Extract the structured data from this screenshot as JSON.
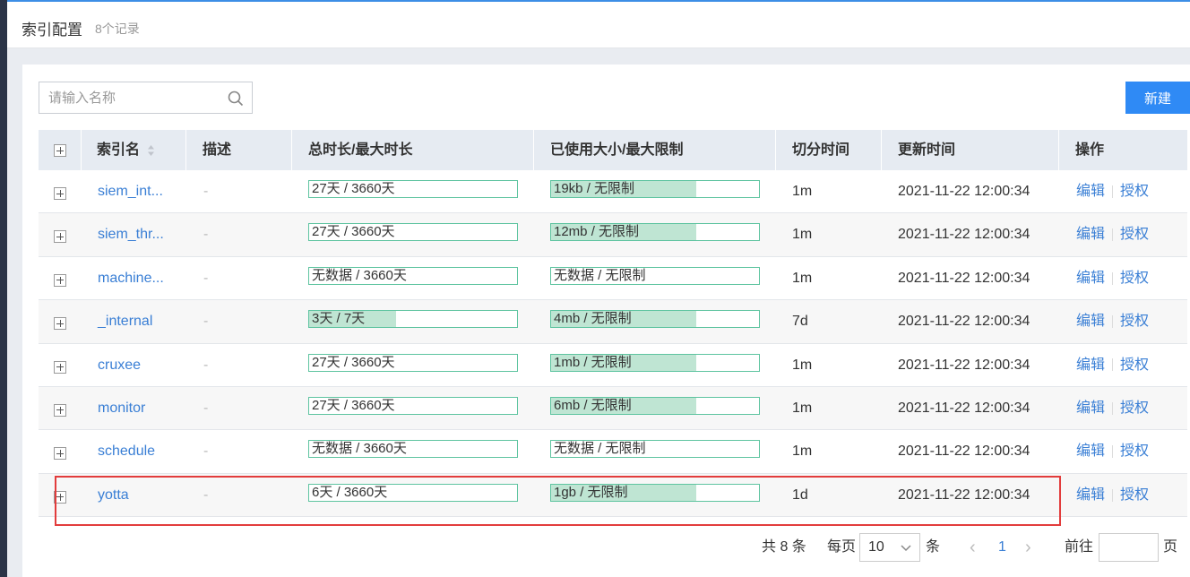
{
  "header": {
    "title": "索引配置",
    "count": "8个记录"
  },
  "search": {
    "placeholder": "请输入名称"
  },
  "toolbar": {
    "new_label": "新建"
  },
  "table": {
    "columns": [
      "索引名",
      "描述",
      "总时长/最大时长",
      "已使用大小/最大限制",
      "切分时间",
      "更新时间",
      "操作"
    ],
    "rows": [
      {
        "name": "siem_int...",
        "desc": "-",
        "duration": "27天 / 3660天",
        "duration_pct": 0,
        "size": "19kb / 无限制",
        "size_pct": 70,
        "split": "1m",
        "updated": "2021-11-22 12:00:34",
        "edit": "编辑",
        "auth": "授权"
      },
      {
        "name": "siem_thr...",
        "desc": "-",
        "duration": "27天 / 3660天",
        "duration_pct": 0,
        "size": "12mb / 无限制",
        "size_pct": 70,
        "split": "1m",
        "updated": "2021-11-22 12:00:34",
        "edit": "编辑",
        "auth": "授权"
      },
      {
        "name": "machine...",
        "desc": "-",
        "duration": "无数据 / 3660天",
        "duration_pct": 0,
        "size": "无数据 / 无限制",
        "size_pct": 0,
        "split": "1m",
        "updated": "2021-11-22 12:00:34",
        "edit": "编辑",
        "auth": "授权"
      },
      {
        "name": "_internal",
        "desc": "-",
        "duration": "3天 / 7天",
        "duration_pct": 42,
        "size": "4mb / 无限制",
        "size_pct": 70,
        "split": "7d",
        "updated": "2021-11-22 12:00:34",
        "edit": "编辑",
        "auth": "授权"
      },
      {
        "name": "cruxee",
        "desc": "-",
        "duration": "27天 / 3660天",
        "duration_pct": 0,
        "size": "1mb / 无限制",
        "size_pct": 70,
        "split": "1m",
        "updated": "2021-11-22 12:00:34",
        "edit": "编辑",
        "auth": "授权"
      },
      {
        "name": "monitor",
        "desc": "-",
        "duration": "27天 / 3660天",
        "duration_pct": 0,
        "size": "6mb / 无限制",
        "size_pct": 70,
        "split": "1m",
        "updated": "2021-11-22 12:00:34",
        "edit": "编辑",
        "auth": "授权"
      },
      {
        "name": "schedule",
        "desc": "-",
        "duration": "无数据 / 3660天",
        "duration_pct": 0,
        "size": "无数据 / 无限制",
        "size_pct": 0,
        "split": "1m",
        "updated": "2021-11-22 12:00:34",
        "edit": "编辑",
        "auth": "授权"
      },
      {
        "name": "yotta",
        "desc": "-",
        "duration": "6天 / 3660天",
        "duration_pct": 0,
        "size": "1gb / 无限制",
        "size_pct": 70,
        "split": "1d",
        "updated": "2021-11-22 12:00:34",
        "edit": "编辑",
        "auth": "授权"
      }
    ]
  },
  "pagination": {
    "total": "共 8 条",
    "per_page_label": "每页",
    "per_page_value": "10",
    "per_page_unit": "条",
    "prev": "‹",
    "current": "1",
    "next": "›",
    "goto_label": "前往",
    "goto_unit": "页"
  }
}
